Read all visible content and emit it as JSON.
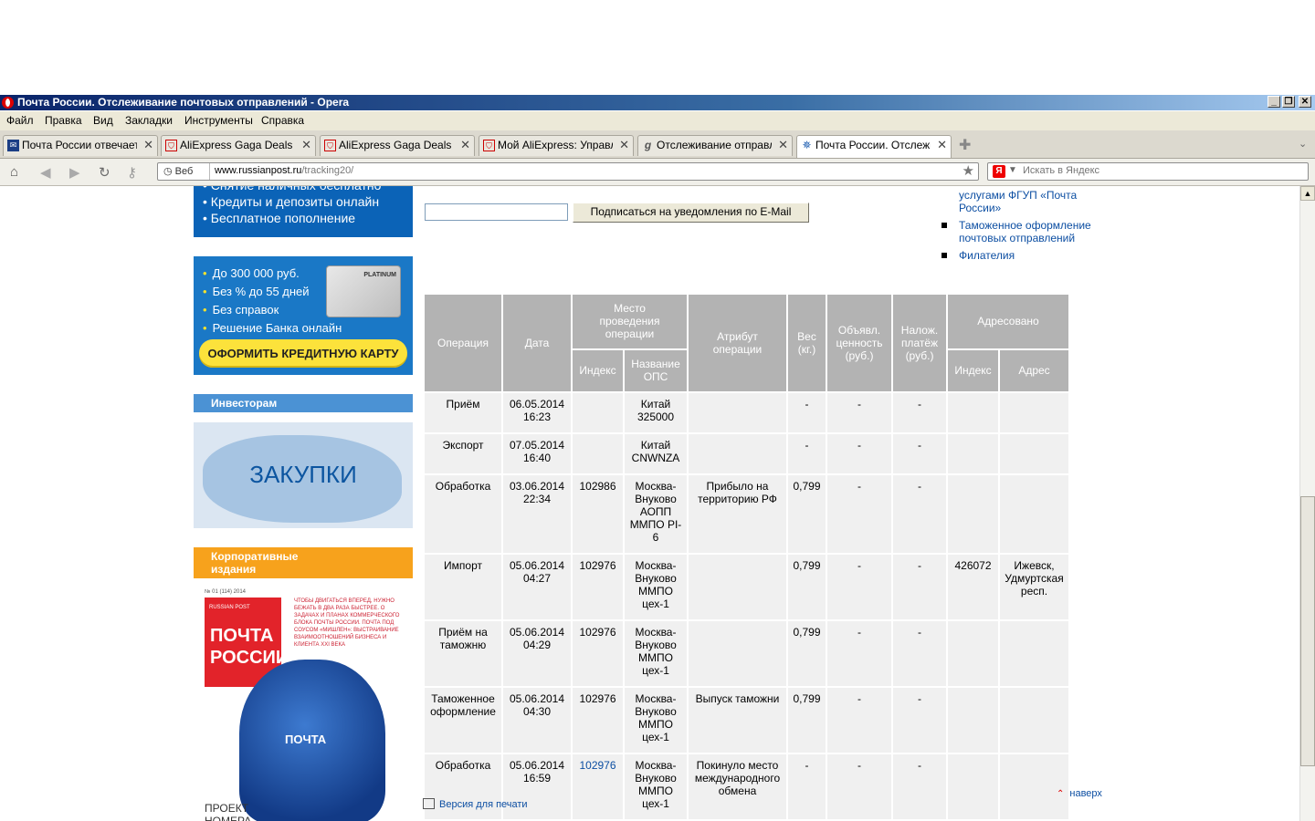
{
  "window": {
    "title": "Почта России. Отслеживание почтовых отправлений - Opera"
  },
  "menu": [
    "Файл",
    "Правка",
    "Вид",
    "Закладки",
    "Инструменты",
    "Справка"
  ],
  "tabs": [
    {
      "label": "Почта России отвечает...",
      "icon": "mail-icon"
    },
    {
      "label": "AliExpress Gaga Deals B...",
      "icon": "cart-icon"
    },
    {
      "label": "AliExpress Gaga Deals P...",
      "icon": "cart-icon"
    },
    {
      "label": "Мой AliExpress: Управл...",
      "icon": "cart-icon"
    },
    {
      "label": "Отслеживание отправл...",
      "icon": "tracking-icon"
    },
    {
      "label": "Почта России. Отслежи...",
      "icon": "eagle-icon"
    }
  ],
  "nav": {
    "web_label": "Веб",
    "url_host": "www.russianpost.ru",
    "url_path": "/tracking20/",
    "search_placeholder": "Искать в Яндекс",
    "search_badge": "Я"
  },
  "banners": {
    "b1_lines": [
      "• Снятие наличных бесплатно",
      "• Кредиты и депозиты онлайн",
      "• Бесплатное пополнение"
    ],
    "b2_items": [
      "До 300 000 руб.",
      "Без % до 55 дней",
      "Без справок",
      "Решение Банка онлайн"
    ],
    "b2_card": "PLATINUM",
    "b2_button": "ОФОРМИТЬ КРЕДИТНУЮ КАРТУ",
    "investors": "Инвесторам",
    "zakupki": "ЗАКУПКИ",
    "corp": "Корпоративные издания",
    "mag_num": "№ 01 (114) 2014",
    "mag_rp": "RUSSIAN POST",
    "mag_title": "ПОЧТА РОССИИ",
    "mag_lines": "ЧТОБЫ ДВИГАТЬСЯ ВПЕРЕД, НУЖНО БЕЖАТЬ В ДВА РАЗА БЫСТРЕЕ. О ЗАДАЧАХ И ПЛАНАХ КОММЕРЧЕСКОГО БЛОКА ПОЧТЫ РОССИИ. ПОЧТА ПОД СОУСОМ «МИШЛЕН»: ВЫСТРАИВАНИЕ ВЗАИМООТНОШЕНИЙ БИЗНЕСА И КЛИЕНТА XXI ВЕКА",
    "mag_bag": "ПОЧТА",
    "mag_proj": "ПРОЕКТ НОМЕРА"
  },
  "subscribe": {
    "button": "Подписаться на уведомления по E-Mail"
  },
  "right_links": [
    "услугами ФГУП «Почта России»",
    "Таможенное оформление почтовых отправлений",
    "Филателия"
  ],
  "table": {
    "headers": {
      "operation": "Операция",
      "date": "Дата",
      "place": "Место проведения операции",
      "attribute": "Атрибут операции",
      "weight": "Вес (кг.)",
      "value": "Объявл. ценность (руб.)",
      "cod": "Налож. платёж (руб.)",
      "addressed": "Адресовано",
      "place_index": "Индекс",
      "place_name": "Название ОПС",
      "addr_index": "Индекс",
      "addr_address": "Адрес"
    },
    "rows": [
      {
        "op": "Приём",
        "date": "06.05.2014 16:23",
        "idx": "",
        "name": "Китай 325000",
        "attr": "",
        "w": "-",
        "v": "-",
        "c": "-",
        "aidx": "",
        "addr": ""
      },
      {
        "op": "Экспорт",
        "date": "07.05.2014 16:40",
        "idx": "",
        "name": "Китай CNWNZA",
        "attr": "",
        "w": "-",
        "v": "-",
        "c": "-",
        "aidx": "",
        "addr": ""
      },
      {
        "op": "Обработка",
        "date": "03.06.2014 22:34",
        "idx": "102986",
        "name": "Москва-Внуково АОПП ММПО PI-6",
        "attr": "Прибыло на территорию РФ",
        "w": "0,799",
        "v": "-",
        "c": "-",
        "aidx": "",
        "addr": ""
      },
      {
        "op": "Импорт",
        "date": "05.06.2014 04:27",
        "idx": "102976",
        "name": "Москва-Внуково ММПО цех-1",
        "attr": "",
        "w": "0,799",
        "v": "-",
        "c": "-",
        "aidx": "426072",
        "addr": "Ижевск, Удмуртская респ."
      },
      {
        "op": "Приём на таможню",
        "date": "05.06.2014 04:29",
        "idx": "102976",
        "name": "Москва-Внуково ММПО цех-1",
        "attr": "",
        "w": "0,799",
        "v": "-",
        "c": "-",
        "aidx": "",
        "addr": ""
      },
      {
        "op": "Таможенное оформление",
        "date": "05.06.2014 04:30",
        "idx": "102976",
        "name": "Москва-Внуково ММПО цех-1",
        "attr": "Выпуск таможни",
        "w": "0,799",
        "v": "-",
        "c": "-",
        "aidx": "",
        "addr": ""
      },
      {
        "op": "Обработка",
        "date": "05.06.2014 16:59",
        "idx": "102976",
        "name": "Москва-Внуково ММПО цех-1",
        "attr": "Покинуло место международного обмена",
        "w": "-",
        "v": "-",
        "c": "-",
        "aidx": "",
        "addr": "",
        "idx_link": true
      }
    ]
  },
  "footer": {
    "print": "Версия для печати",
    "top": "наверх"
  }
}
